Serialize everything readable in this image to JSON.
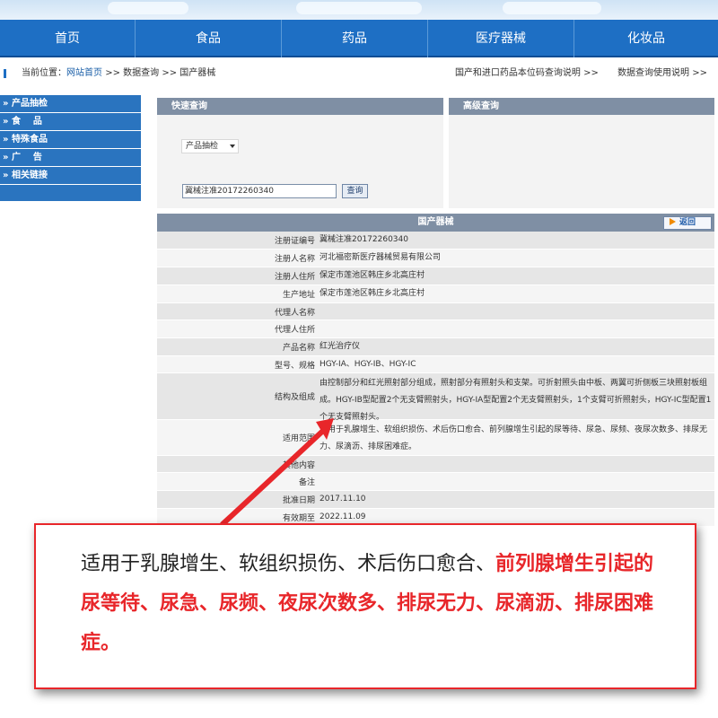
{
  "colors": {
    "nav_bg": "#1e6fc4",
    "sidebar_bg": "#2a74bf",
    "panel_head_bg": "#7f8fa4",
    "callout_border": "#e8262a"
  },
  "nav": {
    "items": [
      "首页",
      "食品",
      "药品",
      "医疗器械",
      "化妆品"
    ]
  },
  "breadcrumb": {
    "prefix": "当前位置：",
    "home": "网站首页",
    "sep1": ">>",
    "query": "数据查询",
    "sep2": ">>",
    "current": "国产器械",
    "link1": "国产和进口药品本位码查询说明 >>",
    "link2": "数据查询使用说明 >>"
  },
  "sidebar": {
    "items": [
      "» 产品抽检",
      "» 食    品",
      "» 特殊食品",
      "» 广    告",
      "» 相关链接"
    ]
  },
  "quick_query": {
    "title": "快速查询",
    "select_value": "产品抽检",
    "input_value": "冀械注准20172260340",
    "button_label": "查询"
  },
  "advanced_query": {
    "title": "高级查询"
  },
  "detail": {
    "title": "国产器械",
    "back_label": "返回",
    "rows": [
      {
        "label": "注册证编号",
        "value": "冀械注准20172260340"
      },
      {
        "label": "注册人名称",
        "value": "河北福密斯医疗器械贸易有限公司"
      },
      {
        "label": "注册人住所",
        "value": "保定市莲池区韩庄乡北高庄村"
      },
      {
        "label": "生产地址",
        "value": "保定市莲池区韩庄乡北高庄村"
      },
      {
        "label": "代理人名称",
        "value": ""
      },
      {
        "label": "代理人住所",
        "value": ""
      },
      {
        "label": "产品名称",
        "value": "红光治疗仪"
      },
      {
        "label": "型号、规格",
        "value": "HGY-ⅠA、HGY-ⅠB、HGY-ⅠC"
      },
      {
        "label": "结构及组成",
        "value": "由控制部分和红光照射部分组成，照射部分有照射头和支架。可折射照头由中板、两翼可折侧板三块照射板组成。HGY-ⅠB型配置2个无支臂照射头，HGY-ⅠA型配置2个无支臂照射头，1个支臂可折照射头，HGY-ⅠC型配置1个无支臂照射头。"
      },
      {
        "label": "适用范围",
        "value": "适用于乳腺增生、软组织损伤、术后伤口愈合、前列腺增生引起的尿等待、尿急、尿频、夜尿次数多、排尿无力、尿滴沥、排尿困难症。"
      },
      {
        "label": "其他内容",
        "value": ""
      },
      {
        "label": "备注",
        "value": ""
      },
      {
        "label": "批准日期",
        "value": "2017.11.10"
      },
      {
        "label": "有效期至",
        "value": "2022.11.09"
      }
    ]
  },
  "callout": {
    "normal_text": "适用于乳腺增生、软组织损伤、术后伤口愈合、",
    "highlight_text": "前列腺增生引起的尿等待、尿急、尿频、夜尿次数多、排尿无力、尿滴沥、排尿困难症。"
  }
}
